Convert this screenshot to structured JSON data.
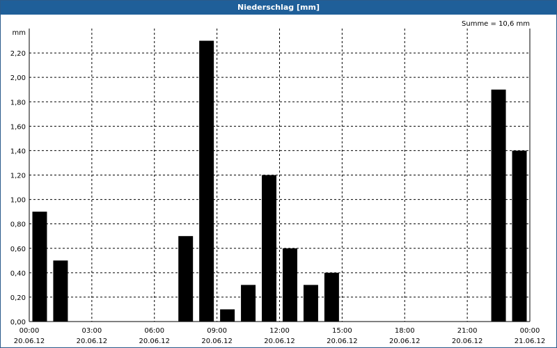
{
  "window": {
    "title": "Niederschlag [mm]"
  },
  "chart_data": {
    "type": "bar",
    "title": "Niederschlag [mm]",
    "ylabel": "mm",
    "ylim": [
      0,
      2.4
    ],
    "y_ticks": [
      "0,00",
      "0,20",
      "0,40",
      "0,60",
      "0,80",
      "1,00",
      "1,20",
      "1,40",
      "1,60",
      "1,80",
      "2,00",
      "2,20"
    ],
    "x_ticks": [
      {
        "time": "00:00",
        "date": "20.06.12"
      },
      {
        "time": "03:00",
        "date": "20.06.12"
      },
      {
        "time": "06:00",
        "date": "20.06.12"
      },
      {
        "time": "09:00",
        "date": "20.06.12"
      },
      {
        "time": "12:00",
        "date": "20.06.12"
      },
      {
        "time": "15:00",
        "date": "20.06.12"
      },
      {
        "time": "18:00",
        "date": "20.06.12"
      },
      {
        "time": "21:00",
        "date": "20.06.12"
      },
      {
        "time": "00:00",
        "date": "21.06.12"
      }
    ],
    "categories": [
      "00:00",
      "01:00",
      "02:00",
      "03:00",
      "04:00",
      "05:00",
      "06:00",
      "07:00",
      "08:00",
      "09:00",
      "10:00",
      "11:00",
      "12:00",
      "13:00",
      "14:00",
      "15:00",
      "16:00",
      "17:00",
      "18:00",
      "19:00",
      "20:00",
      "21:00",
      "22:00",
      "23:00"
    ],
    "values": [
      0.9,
      0.5,
      0,
      0,
      0,
      0,
      0,
      0.7,
      2.3,
      0.1,
      0.3,
      1.2,
      0.6,
      0.3,
      0.4,
      0,
      0,
      0,
      0,
      0,
      0,
      0,
      1.9,
      1.4
    ],
    "annotation": "Summe = 10,6 mm",
    "grid": true,
    "bar_color": "#000000"
  }
}
